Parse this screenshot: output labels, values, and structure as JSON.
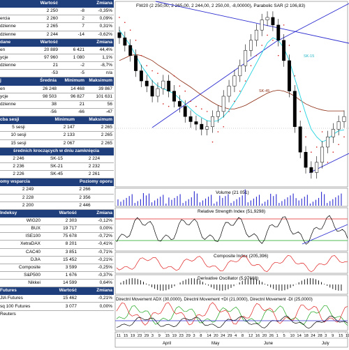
{
  "colors": {
    "header_bg": "#1f3e7c",
    "price_line": "#2a2ad0",
    "cyan_ma": "#1fd2e0",
    "brown_ma": "#8b2a10",
    "green_line": "#1aa51a",
    "red_line": "#e02020",
    "sar": "#d41a1a"
  },
  "stats": {
    "headers": [
      "",
      "Wartość",
      "Zmiana"
    ],
    "rows": [
      [
        "",
        "2 250",
        "-8",
        "-0,35%"
      ],
      [
        "ercia",
        "2 260",
        "2",
        "0,09%"
      ],
      [
        "dzienne",
        "2 265",
        "7",
        "0,31%"
      ],
      [
        "dzienne",
        "2 244",
        "-14",
        "-0,62%"
      ]
    ]
  },
  "volume": {
    "headers": [
      "dane",
      "Wartość",
      "Zmiana"
    ],
    "rows": [
      [
        "en",
        "20 889",
        "6 421",
        "44,4%"
      ],
      [
        "ycje",
        "97 960",
        "1 080",
        "1,1%"
      ],
      [
        "dzienne",
        "21",
        "-2",
        "-8,7%"
      ],
      [
        "",
        "-53",
        "-5",
        "n/a"
      ]
    ]
  },
  "range": {
    "headers": [
      "j",
      "Średnia",
      "Minimum",
      "Maksimum"
    ],
    "rows": [
      [
        "en",
        "26 248",
        "14 468",
        "39 867"
      ],
      [
        "ycje",
        "98 503",
        "96 827",
        "101 631"
      ],
      [
        "dzienne",
        "38",
        "21",
        "56"
      ],
      [
        "",
        "-56",
        "-66",
        "-47"
      ]
    ]
  },
  "sessions": {
    "headers": [
      "cba sesji",
      "Minimum",
      "Maksimum"
    ],
    "rows": [
      [
        "5 sesji",
        "2 147",
        "2 265"
      ],
      [
        "10 sesji",
        "2 133",
        "2 265"
      ],
      [
        "15 sesji",
        "2 067",
        "2 265"
      ]
    ]
  },
  "moving": {
    "header": "średnich kroczących w dniu zamknięcia",
    "rows": [
      [
        "2 246",
        "SK-15",
        "2 224"
      ],
      [
        "2 236",
        "SK-21",
        "2 232"
      ],
      [
        "2 226",
        "SK-45",
        "2 261"
      ]
    ]
  },
  "levels": {
    "headers": [
      "omy wsparcia",
      "Poziomy oporu"
    ],
    "rows": [
      [
        "2 249",
        "2 266"
      ],
      [
        "2 228",
        "2 356"
      ],
      [
        "2 200",
        "2 446"
      ]
    ]
  },
  "indices": {
    "headers": [
      "Indeksy",
      "Wartość",
      "Zmiana"
    ],
    "rows": [
      [
        "WIG20",
        "2 303",
        "-0,12%"
      ],
      [
        "BUX",
        "19 717",
        "0,00%"
      ],
      [
        "ISE100",
        "75 678",
        "-0,72%"
      ],
      [
        "XetraDAX",
        "8 201",
        "-0,41%"
      ],
      [
        "CAC40",
        "3 851",
        "-0,71%"
      ],
      [
        "DJIA",
        "15 452",
        "-0,21%"
      ],
      [
        "Composite",
        "3 599",
        "-0,25%"
      ],
      [
        "S&P500",
        "1 676",
        "-0,37%"
      ],
      [
        "Nikkei",
        "14 599",
        "0,64%"
      ]
    ]
  },
  "futures": {
    "headers": [
      "Futures",
      "Wartość",
      "Zmiana"
    ],
    "rows": [
      [
        "JIA Futures",
        "15 462",
        "-0,21%"
      ],
      [
        "sq 100 Futures",
        "3 077",
        "0,00%"
      ]
    ],
    "footer": "Reuters"
  },
  "chart": {
    "title": "FW20 (2 250,00, 2 265,00, 2 244,00, 2 250,00, -8,00000), Parabolic SAR (2 106,83)",
    "labels": {
      "sk15": "SK-15",
      "sk45": "SK-45"
    },
    "volume_title": "Volume (21 051)",
    "rsi_title": "Relative Strength Index (51,9298)",
    "composite_title": "Composite Index (205,396)",
    "deriv_title": "Derivative Oscillator (5,97688)",
    "dmi_title": "Directnl Movement ADX (30,0000), Directnl Movement +DI (21,0000), Directnl Movement -DI (25,0000)",
    "x_days": [
      "11",
      "15",
      "19",
      "23",
      "29",
      "3",
      "9",
      "15",
      "19",
      "23",
      "29",
      "3",
      "8",
      "14",
      "20",
      "24",
      "29",
      "4",
      "8",
      "12",
      "16",
      "20",
      "26",
      "1",
      "5",
      "10",
      "14",
      "18",
      "24",
      "28",
      "3",
      "9",
      "15",
      "19"
    ],
    "months": [
      "April",
      "May",
      "June",
      "July"
    ]
  },
  "chart_data": {
    "type": "line",
    "title": "FW20 (2 250,00, 2 265,00, 2 244,00, 2 250,00, -8,00000), Parabolic SAR (2 106,83)",
    "series": [
      {
        "name": "FW20",
        "values": [
          2405,
          2390,
          2370,
          2340,
          2320,
          2310,
          2290,
          2305,
          2320,
          2300,
          2280,
          2270,
          2250,
          2240,
          2235,
          2225,
          2230,
          2250,
          2260,
          2290,
          2310,
          2330,
          2350,
          2380,
          2400,
          2420,
          2440,
          2445,
          2430,
          2400,
          2360,
          2300,
          2230,
          2180,
          2150,
          2140,
          2160,
          2190,
          2210,
          2225,
          2240,
          2250
        ]
      },
      {
        "name": "SK-15",
        "values": [
          2420,
          2405,
          2390,
          2370,
          2350,
          2335,
          2320,
          2310,
          2305,
          2300,
          2295,
          2285,
          2275,
          2265,
          2255,
          2248,
          2242,
          2240,
          2242,
          2250,
          2262,
          2278,
          2295,
          2315,
          2335,
          2355,
          2375,
          2395,
          2405,
          2400,
          2385,
          2360,
          2325,
          2290,
          2255,
          2225,
          2210,
          2200,
          2205,
          2215,
          2222,
          2224
        ]
      },
      {
        "name": "SK-45",
        "values": [
          2360,
          2365,
          2370,
          2372,
          2370,
          2365,
          2360,
          2352,
          2345,
          2338,
          2330,
          2322,
          2315,
          2308,
          2300,
          2292,
          2285,
          2278,
          2272,
          2268,
          2265,
          2265,
          2268,
          2272,
          2278,
          2284,
          2290,
          2296,
          2300,
          2302,
          2300,
          2296,
          2290,
          2282,
          2275,
          2270,
          2266,
          2263,
          2261,
          2261,
          2261,
          2261
        ]
      }
    ]
  }
}
